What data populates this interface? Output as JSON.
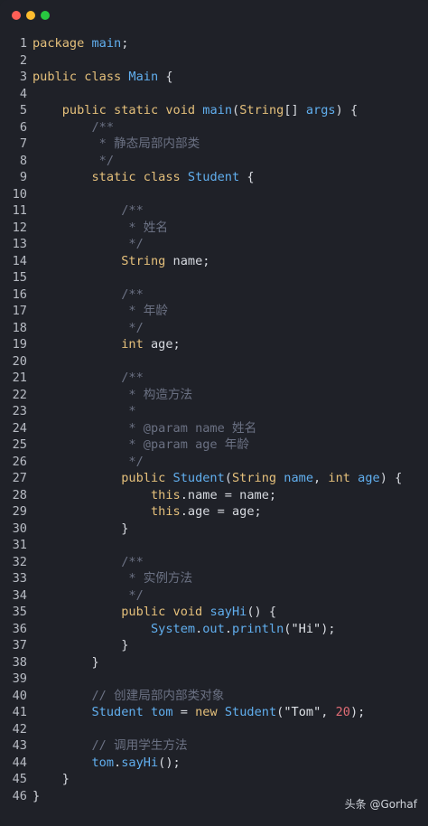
{
  "window": {
    "controls": [
      {
        "name": "close",
        "color": "#ff5f57"
      },
      {
        "name": "minimize",
        "color": "#febc2e"
      },
      {
        "name": "zoom",
        "color": "#28c840"
      }
    ]
  },
  "code": {
    "lines": [
      {
        "n": "1",
        "tokens": [
          [
            "kw",
            "package"
          ],
          [
            "pl",
            " "
          ],
          [
            "pkg",
            "main"
          ],
          [
            "pl",
            ";"
          ]
        ]
      },
      {
        "n": "2",
        "tokens": []
      },
      {
        "n": "3",
        "tokens": [
          [
            "kw",
            "public class"
          ],
          [
            "pl",
            " "
          ],
          [
            "cls",
            "Main"
          ],
          [
            "pl",
            " {"
          ]
        ]
      },
      {
        "n": "4",
        "tokens": []
      },
      {
        "n": "5",
        "tokens": [
          [
            "pl",
            "    "
          ],
          [
            "kw",
            "public static void"
          ],
          [
            "pl",
            " "
          ],
          [
            "fn",
            "main"
          ],
          [
            "pl",
            "("
          ],
          [
            "ty",
            "String"
          ],
          [
            "pl",
            "[] "
          ],
          [
            "cls",
            "args"
          ],
          [
            "pl",
            ") {"
          ]
        ]
      },
      {
        "n": "6",
        "tokens": [
          [
            "pl",
            "        "
          ],
          [
            "cm",
            "/**"
          ]
        ]
      },
      {
        "n": "7",
        "tokens": [
          [
            "pl",
            "         "
          ],
          [
            "cm",
            "* 静态局部内部类"
          ]
        ]
      },
      {
        "n": "8",
        "tokens": [
          [
            "pl",
            "         "
          ],
          [
            "cm",
            "*/"
          ]
        ]
      },
      {
        "n": "9",
        "tokens": [
          [
            "pl",
            "        "
          ],
          [
            "kw",
            "static class"
          ],
          [
            "pl",
            " "
          ],
          [
            "cls",
            "Student"
          ],
          [
            "pl",
            " {"
          ]
        ]
      },
      {
        "n": "10",
        "tokens": []
      },
      {
        "n": "11",
        "tokens": [
          [
            "pl",
            "            "
          ],
          [
            "cm",
            "/**"
          ]
        ]
      },
      {
        "n": "12",
        "tokens": [
          [
            "pl",
            "             "
          ],
          [
            "cm",
            "* 姓名"
          ]
        ]
      },
      {
        "n": "13",
        "tokens": [
          [
            "pl",
            "             "
          ],
          [
            "cm",
            "*/"
          ]
        ]
      },
      {
        "n": "14",
        "tokens": [
          [
            "pl",
            "            "
          ],
          [
            "ty",
            "String"
          ],
          [
            "pl",
            " "
          ],
          [
            "pl",
            "name;"
          ]
        ]
      },
      {
        "n": "15",
        "tokens": []
      },
      {
        "n": "16",
        "tokens": [
          [
            "pl",
            "            "
          ],
          [
            "cm",
            "/**"
          ]
        ]
      },
      {
        "n": "17",
        "tokens": [
          [
            "pl",
            "             "
          ],
          [
            "cm",
            "* 年龄"
          ]
        ]
      },
      {
        "n": "18",
        "tokens": [
          [
            "pl",
            "             "
          ],
          [
            "cm",
            "*/"
          ]
        ]
      },
      {
        "n": "19",
        "tokens": [
          [
            "pl",
            "            "
          ],
          [
            "kw",
            "int"
          ],
          [
            "pl",
            " "
          ],
          [
            "pl",
            "age;"
          ]
        ]
      },
      {
        "n": "20",
        "tokens": []
      },
      {
        "n": "21",
        "tokens": [
          [
            "pl",
            "            "
          ],
          [
            "cm",
            "/**"
          ]
        ]
      },
      {
        "n": "22",
        "tokens": [
          [
            "pl",
            "             "
          ],
          [
            "cm",
            "* 构造方法"
          ]
        ]
      },
      {
        "n": "23",
        "tokens": [
          [
            "pl",
            "             "
          ],
          [
            "cm",
            "*"
          ]
        ]
      },
      {
        "n": "24",
        "tokens": [
          [
            "pl",
            "             "
          ],
          [
            "cm",
            "* @param name 姓名"
          ]
        ]
      },
      {
        "n": "25",
        "tokens": [
          [
            "pl",
            "             "
          ],
          [
            "cm",
            "* @param age 年龄"
          ]
        ]
      },
      {
        "n": "26",
        "tokens": [
          [
            "pl",
            "             "
          ],
          [
            "cm",
            "*/"
          ]
        ]
      },
      {
        "n": "27",
        "tokens": [
          [
            "pl",
            "            "
          ],
          [
            "kw",
            "public"
          ],
          [
            "pl",
            " "
          ],
          [
            "cls",
            "Student"
          ],
          [
            "pl",
            "("
          ],
          [
            "ty",
            "String"
          ],
          [
            "pl",
            " "
          ],
          [
            "cls",
            "name"
          ],
          [
            "pl",
            ", "
          ],
          [
            "kw",
            "int"
          ],
          [
            "pl",
            " "
          ],
          [
            "cls",
            "age"
          ],
          [
            "pl",
            ") {"
          ]
        ]
      },
      {
        "n": "28",
        "tokens": [
          [
            "pl",
            "                "
          ],
          [
            "kw",
            "this"
          ],
          [
            "pl",
            ".name = name;"
          ]
        ]
      },
      {
        "n": "29",
        "tokens": [
          [
            "pl",
            "                "
          ],
          [
            "kw",
            "this"
          ],
          [
            "pl",
            ".age = age;"
          ]
        ]
      },
      {
        "n": "30",
        "tokens": [
          [
            "pl",
            "            }"
          ]
        ]
      },
      {
        "n": "31",
        "tokens": []
      },
      {
        "n": "32",
        "tokens": [
          [
            "pl",
            "            "
          ],
          [
            "cm",
            "/**"
          ]
        ]
      },
      {
        "n": "33",
        "tokens": [
          [
            "pl",
            "             "
          ],
          [
            "cm",
            "* 实例方法"
          ]
        ]
      },
      {
        "n": "34",
        "tokens": [
          [
            "pl",
            "             "
          ],
          [
            "cm",
            "*/"
          ]
        ]
      },
      {
        "n": "35",
        "tokens": [
          [
            "pl",
            "            "
          ],
          [
            "kw",
            "public void"
          ],
          [
            "pl",
            " "
          ],
          [
            "fn",
            "sayHi"
          ],
          [
            "pl",
            "() {"
          ]
        ]
      },
      {
        "n": "36",
        "tokens": [
          [
            "pl",
            "                "
          ],
          [
            "cls",
            "System"
          ],
          [
            "pl",
            "."
          ],
          [
            "cls",
            "out"
          ],
          [
            "pl",
            "."
          ],
          [
            "fn",
            "println"
          ],
          [
            "pl",
            "("
          ],
          [
            "str",
            "\"Hi\""
          ],
          [
            "pl",
            ");"
          ]
        ]
      },
      {
        "n": "37",
        "tokens": [
          [
            "pl",
            "            }"
          ]
        ]
      },
      {
        "n": "38",
        "tokens": [
          [
            "pl",
            "        }"
          ]
        ]
      },
      {
        "n": "39",
        "tokens": []
      },
      {
        "n": "40",
        "tokens": [
          [
            "pl",
            "        "
          ],
          [
            "cm",
            "// 创建局部内部类对象"
          ]
        ]
      },
      {
        "n": "41",
        "tokens": [
          [
            "pl",
            "        "
          ],
          [
            "cls",
            "Student"
          ],
          [
            "pl",
            " "
          ],
          [
            "cls",
            "tom"
          ],
          [
            "pl",
            " = "
          ],
          [
            "kw",
            "new"
          ],
          [
            "pl",
            " "
          ],
          [
            "cls",
            "Student"
          ],
          [
            "pl",
            "("
          ],
          [
            "str",
            "\"Tom\""
          ],
          [
            "pl",
            ", "
          ],
          [
            "num",
            "20"
          ],
          [
            "pl",
            ");"
          ]
        ]
      },
      {
        "n": "42",
        "tokens": []
      },
      {
        "n": "43",
        "tokens": [
          [
            "pl",
            "        "
          ],
          [
            "cm",
            "// 调用学生方法"
          ]
        ]
      },
      {
        "n": "44",
        "tokens": [
          [
            "pl",
            "        "
          ],
          [
            "cls",
            "tom"
          ],
          [
            "pl",
            "."
          ],
          [
            "fn",
            "sayHi"
          ],
          [
            "pl",
            "();"
          ]
        ]
      },
      {
        "n": "45",
        "tokens": [
          [
            "pl",
            "    }"
          ]
        ]
      },
      {
        "n": "46",
        "tokens": [
          [
            "pl",
            "}"
          ]
        ]
      }
    ]
  },
  "watermark": "头条 @Gorhaf"
}
